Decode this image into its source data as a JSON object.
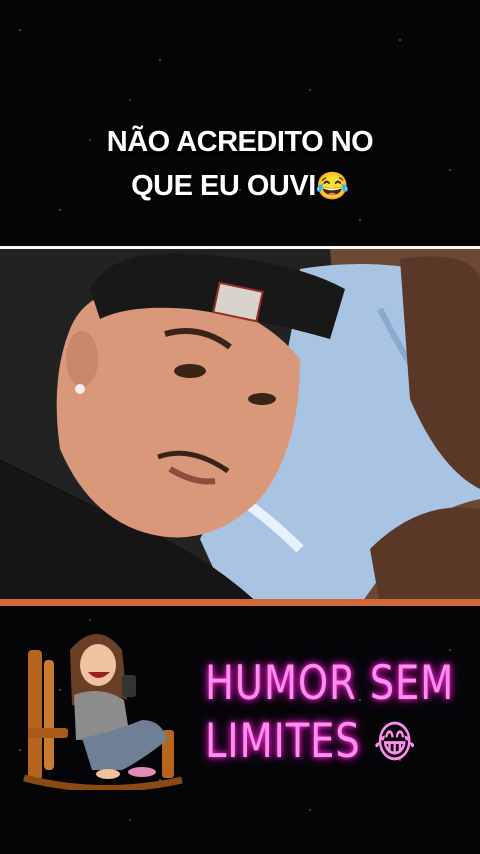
{
  "caption": {
    "line1": "NÃO ACREDITO NO",
    "line2": "QUE EU OUVI",
    "emoji": "😂"
  },
  "video": {
    "description_icon": "video-frame"
  },
  "banner": {
    "line1": "HUMOR SEM",
    "line2": "LIMITES",
    "emoji": "😂"
  },
  "colors": {
    "background": "#050508",
    "caption_text": "#ffffff",
    "banner_text": "#ff8df0",
    "banner_glow": "#ff2fd2",
    "video_border_bottom": "#d2693a"
  }
}
